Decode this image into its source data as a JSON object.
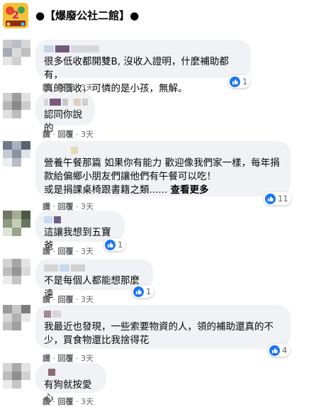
{
  "group": {
    "title": "●【爆廢公社二館】●",
    "logo_color": "#f4c23a"
  },
  "actions": {
    "like": "讚",
    "sep": "·",
    "reply": "回覆",
    "time": "3天"
  },
  "comments": [
    {
      "lines": [
        "很多低收都開雙B, 沒收入證明，什麼補助都有，",
        "真的低收，可憐的是小孩，無解。"
      ],
      "likes": "1"
    },
    {
      "lines": [
        "認同你說的"
      ],
      "likes": ""
    },
    {
      "lines": [
        "營養午餐那篇 如果你有能力 歡迎像我們家一樣，每年捐",
        "款給偏鄉小朋友們讓他們有午餐可以吃！",
        "或是捐課桌椅跟書籍之類......"
      ],
      "see_more": "查看更多",
      "likes": "11"
    },
    {
      "lines": [
        "這讓我想到五寶爸"
      ],
      "likes": "1"
    },
    {
      "lines": [
        "不是每個人都能想那麼遠"
      ],
      "likes": "1"
    },
    {
      "lines": [
        "我最近也發現，一些索要物資的人，領的補助還真的不",
        "少，買食物還比我捨得花"
      ],
      "likes": "4"
    },
    {
      "lines": [
        "有狗就按愛心"
      ],
      "likes": ""
    }
  ],
  "colors": {
    "bubble": "#f0f2f5",
    "like_blue": "#1877f2",
    "meta_gray": "#65676b"
  }
}
